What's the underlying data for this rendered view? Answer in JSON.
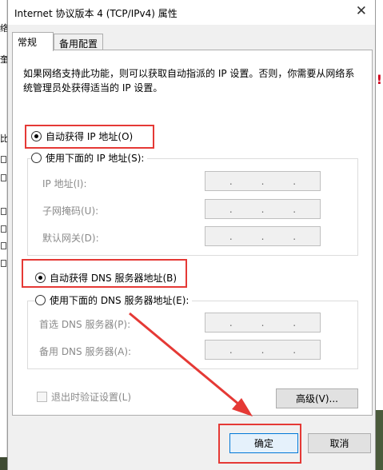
{
  "window": {
    "title": "Internet 协议版本 4 (TCP/IPv4) 属性",
    "close_glyph": "✕"
  },
  "background": {
    "left_fragments": [
      "络",
      "奎",
      "比"
    ],
    "right_mark": "!"
  },
  "tabs": [
    {
      "label": "常规",
      "active": true
    },
    {
      "label": "备用配置",
      "active": false
    }
  ],
  "description": "如果网络支持此功能，则可以获取自动指派的 IP 设置。否则，你需要从网络系统管理员处获得适当的 IP 设置。",
  "ip_section": {
    "auto_label": "自动获得 IP 地址(O)",
    "auto_selected": true,
    "manual_label": "使用下面的 IP 地址(S):",
    "manual_selected": false,
    "fields": [
      {
        "label": "IP 地址(I):"
      },
      {
        "label": "子网掩码(U):"
      },
      {
        "label": "默认网关(D):"
      }
    ]
  },
  "dns_section": {
    "auto_label": "自动获得 DNS 服务器地址(B)",
    "auto_selected": true,
    "manual_label": "使用下面的 DNS 服务器地址(E):",
    "manual_selected": false,
    "fields": [
      {
        "label": "首选 DNS 服务器(P):"
      },
      {
        "label": "备用 DNS 服务器(A):"
      }
    ]
  },
  "ip_dot": ".",
  "validate_label": "退出时验证设置(L)",
  "advanced_label": "高级(V)...",
  "ok_label": "确定",
  "cancel_label": "取消",
  "colors": {
    "highlight": "#e53935",
    "ok_border": "#0078d7"
  },
  "icons": {
    "close": "close-icon",
    "radio": "radio-dot-icon"
  }
}
